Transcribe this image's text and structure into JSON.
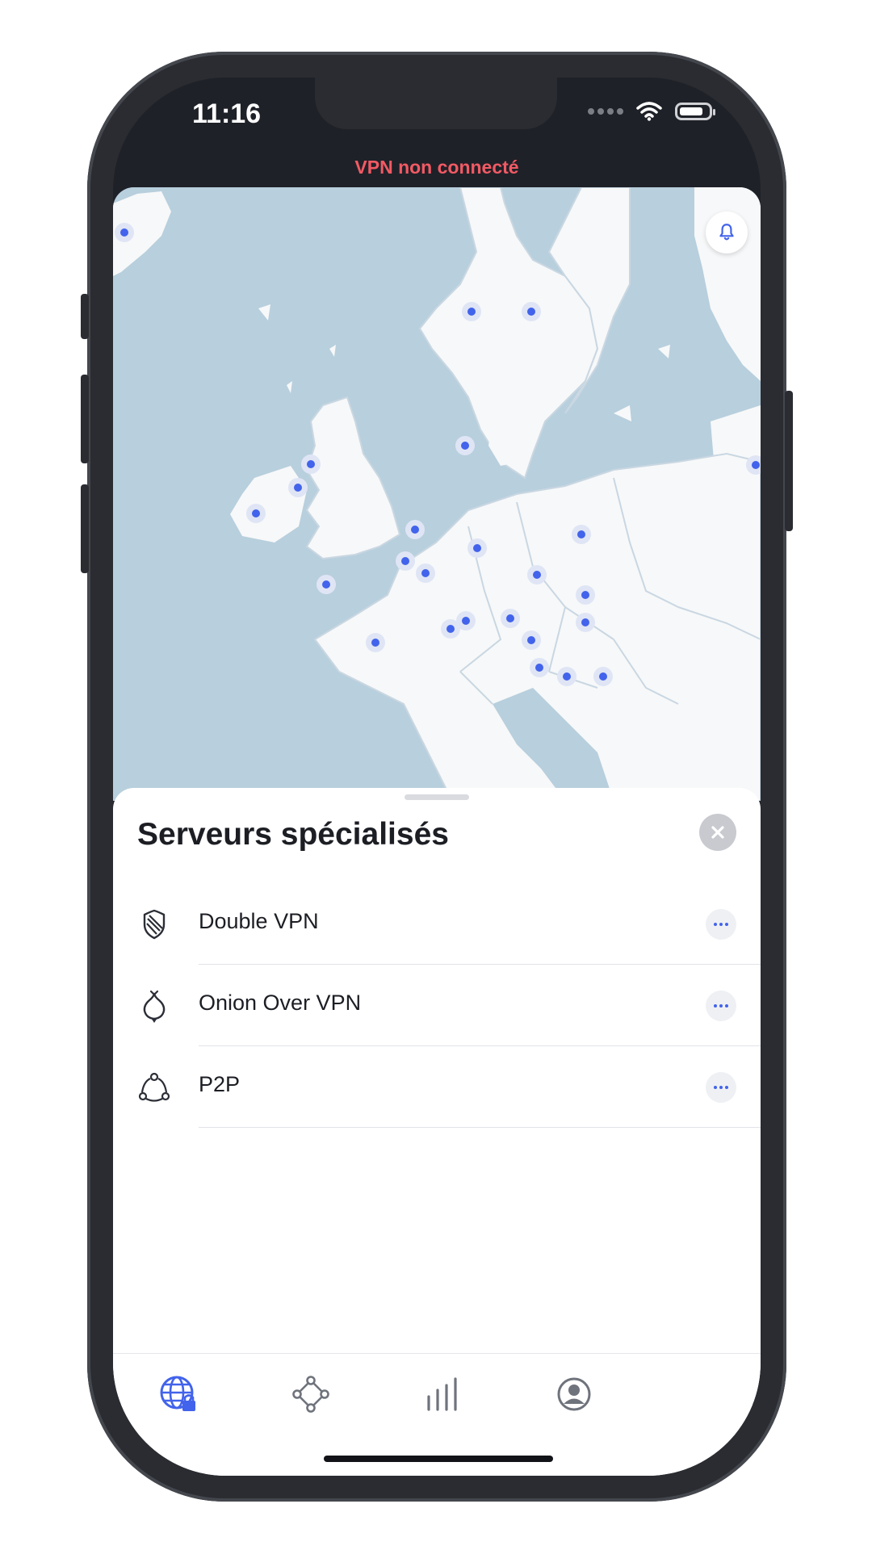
{
  "status_bar": {
    "time": "11:16"
  },
  "vpn": {
    "status_text": "VPN non connecté"
  },
  "sheet": {
    "title": "Serveurs spécialisés",
    "items": [
      {
        "label": "Double VPN",
        "icon": "double-vpn-shield-icon"
      },
      {
        "label": "Onion Over VPN",
        "icon": "onion-icon"
      },
      {
        "label": "P2P",
        "icon": "p2p-icon"
      }
    ]
  },
  "tab_bar": {
    "tabs": [
      {
        "icon": "globe-lock-icon",
        "active": true
      },
      {
        "icon": "meshnet-icon",
        "active": false
      },
      {
        "icon": "stats-bars-icon",
        "active": false
      },
      {
        "icon": "profile-icon",
        "active": false
      }
    ]
  },
  "colors": {
    "accent": "#4263eb",
    "status_disconnected": "#f25a64",
    "map_water": "#b8cfdd",
    "map_land": "#f7f8f9"
  }
}
